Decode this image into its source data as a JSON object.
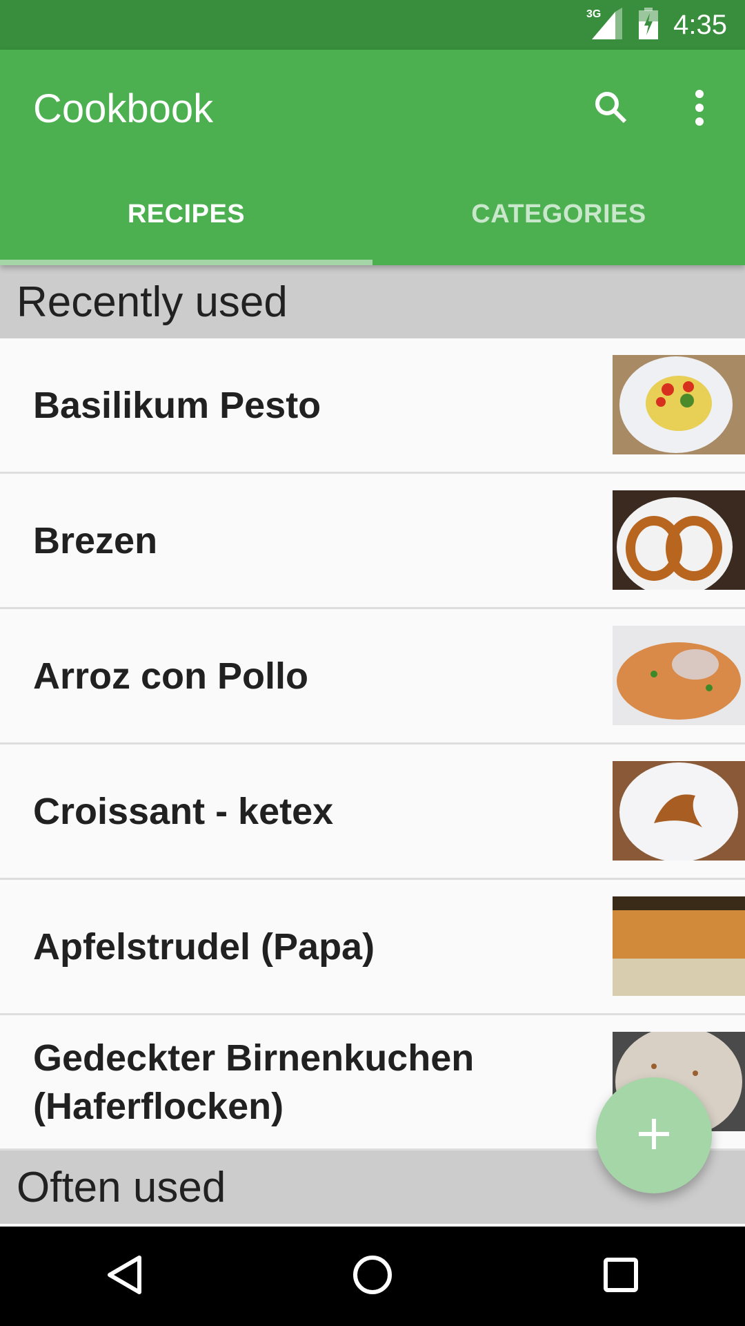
{
  "status_bar": {
    "network": "3G",
    "time": "4:35"
  },
  "app_bar": {
    "title": "Cookbook",
    "actions": [
      {
        "icon": "search-icon",
        "label": "Search"
      },
      {
        "icon": "more-vert-icon",
        "label": "More options"
      }
    ]
  },
  "tabs": [
    {
      "label": "RECIPES",
      "active": true
    },
    {
      "label": "CATEGORIES",
      "active": false
    }
  ],
  "sections": [
    {
      "title": "Recently used",
      "items": [
        {
          "title": "Basilikum Pesto",
          "thumb": "pasta-plate-image"
        },
        {
          "title": "Brezen",
          "thumb": "pretzel-image"
        },
        {
          "title": "Arroz con Pollo",
          "thumb": "rice-chicken-image"
        },
        {
          "title": "Croissant - ketex",
          "thumb": "croissant-image"
        },
        {
          "title": "Apfelstrudel (Papa)",
          "thumb": "strudel-image"
        },
        {
          "title": "Gedeckter Birnenkuchen (Haferflocken)",
          "thumb": "pear-cake-image"
        }
      ]
    },
    {
      "title": "Often used",
      "items": []
    }
  ],
  "fab": {
    "icon": "plus-icon",
    "label": "Add recipe"
  },
  "nav_bar": {
    "buttons": [
      "back",
      "home",
      "recents"
    ]
  },
  "colors": {
    "primary": "#4caf50",
    "primary_dark": "#388e3c",
    "accent": "#a5d6a7",
    "section_bg": "#cccccc"
  }
}
